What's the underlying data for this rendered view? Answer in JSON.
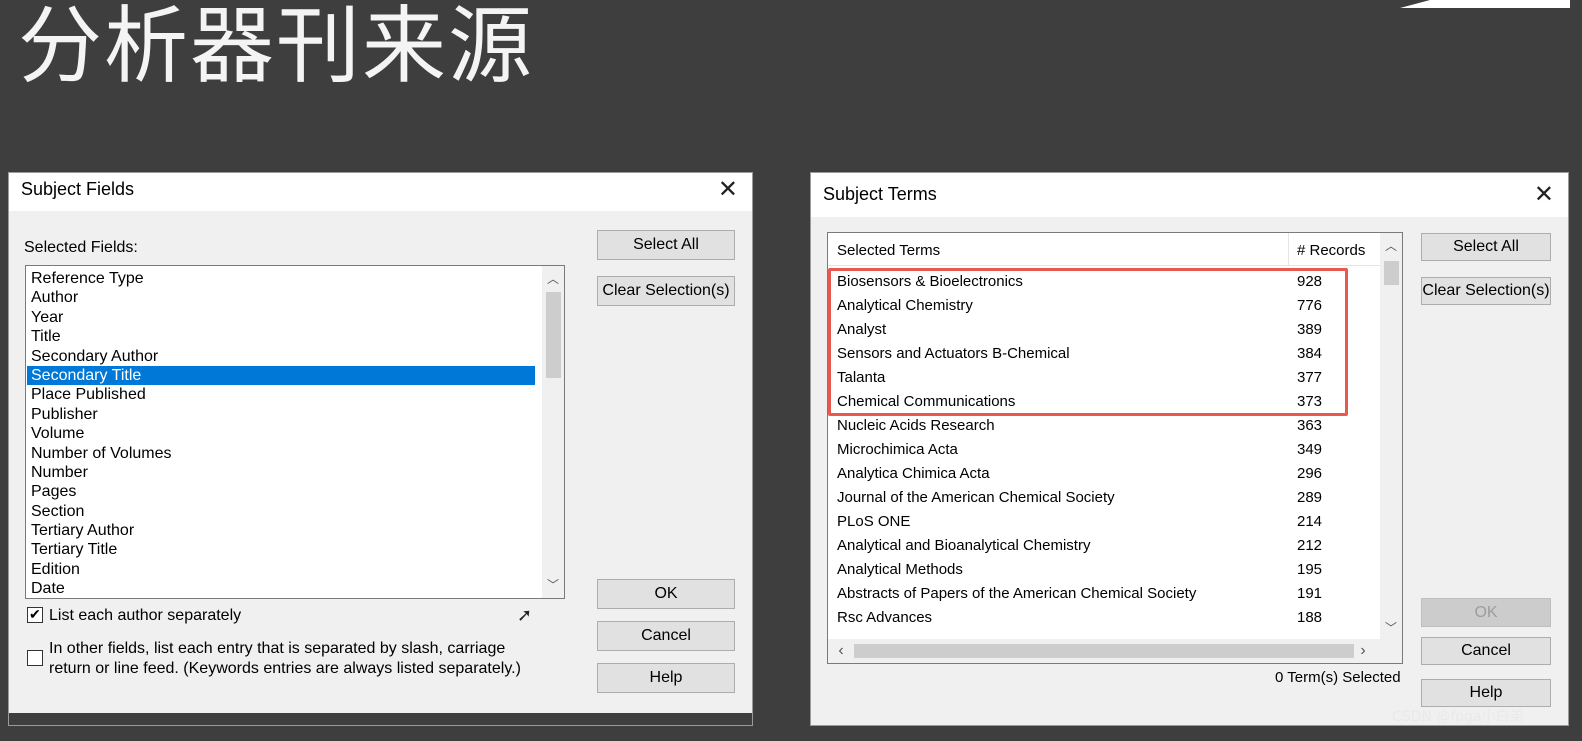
{
  "slide": {
    "title": "分析器刊来源"
  },
  "subject_fields": {
    "title": "Subject Fields",
    "selected_fields_label": "Selected Fields:",
    "fields": [
      "Reference Type",
      "Author",
      "Year",
      "Title",
      "Secondary Author",
      "Secondary Title",
      "Place Published",
      "Publisher",
      "Volume",
      "Number of Volumes",
      "Number",
      "Pages",
      "Section",
      "Tertiary Author",
      "Tertiary Title",
      "Edition",
      "Date"
    ],
    "selected_index": 5,
    "buttons": {
      "select_all": "Select All",
      "clear_selection": "Clear Selection(s)",
      "ok": "OK",
      "cancel": "Cancel",
      "help": "Help"
    },
    "checkbox_list_authors": {
      "label": "List each author separately",
      "checked": true
    },
    "checkbox_other_fields": {
      "line1": "In other fields, list each entry that is separated by slash, carriage",
      "line2": "return or line feed. (Keywords entries are always listed separately.)",
      "checked": false
    },
    "close_glyph": "✕"
  },
  "subject_terms": {
    "title": "Subject Terms",
    "column_terms": "Selected Terms",
    "column_records": "# Records",
    "rows": [
      {
        "term": "Biosensors & Bioelectronics",
        "records": "928"
      },
      {
        "term": "Analytical Chemistry",
        "records": "776"
      },
      {
        "term": "Analyst",
        "records": "389"
      },
      {
        "term": "Sensors and Actuators B-Chemical",
        "records": "384"
      },
      {
        "term": "Talanta",
        "records": "377"
      },
      {
        "term": "Chemical Communications",
        "records": "373"
      },
      {
        "term": "Nucleic Acids Research",
        "records": "363"
      },
      {
        "term": "Microchimica Acta",
        "records": "349"
      },
      {
        "term": "Analytica Chimica Acta",
        "records": "296"
      },
      {
        "term": "Journal of the American Chemical Society",
        "records": "289"
      },
      {
        "term": "PLoS ONE",
        "records": "214"
      },
      {
        "term": "Analytical and Bioanalytical Chemistry",
        "records": "212"
      },
      {
        "term": "Analytical Methods",
        "records": "195"
      },
      {
        "term": "Abstracts of Papers of the American Chemical Society",
        "records": "191"
      },
      {
        "term": "Rsc Advances",
        "records": "188"
      }
    ],
    "highlight_rows": 6,
    "status": "0 Term(s) Selected",
    "buttons": {
      "select_all": "Select All",
      "clear_selection": "Clear Selection(s)",
      "ok": "OK",
      "cancel": "Cancel",
      "help": "Help"
    },
    "close_glyph": "✕"
  },
  "watermark": "CSDN @fpga小白弟",
  "colors": {
    "selection": "#0078d7",
    "highlight": "#e8584f",
    "slide_bg": "#3e3e3e"
  }
}
